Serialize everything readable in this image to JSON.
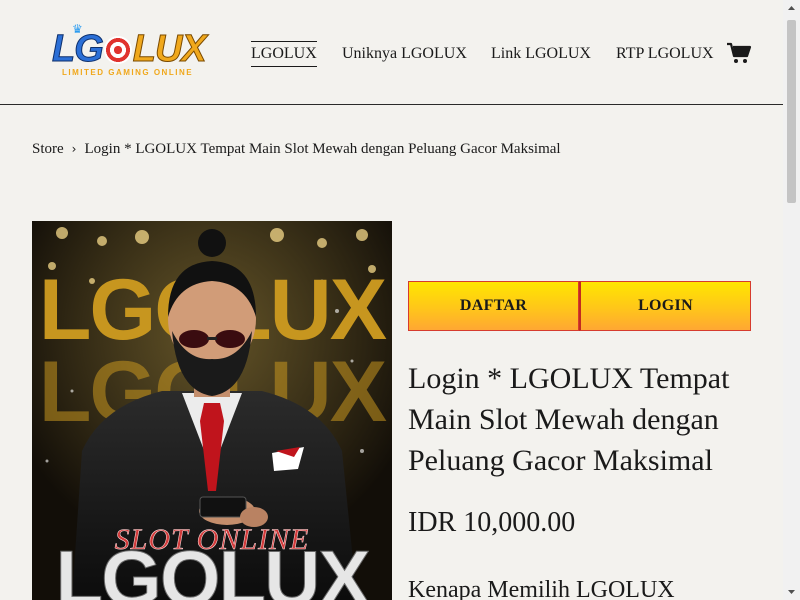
{
  "logo": {
    "text_part1": "LG",
    "text_part2": "LUX",
    "tagline": "LIMITED GAMING ONLINE"
  },
  "nav": {
    "items": [
      {
        "label": "LGOLUX",
        "active": true
      },
      {
        "label": "Uniknya LGOLUX",
        "active": false
      },
      {
        "label": "Link LGOLUX",
        "active": false
      },
      {
        "label": "RTP LGOLUX",
        "active": false
      }
    ],
    "cart_icon": "cart-icon"
  },
  "breadcrumb": {
    "root": "Store",
    "separator": "›",
    "current": "Login * LGOLUX Tempat Main Slot Mewah dengan Peluang Gacor Maksimal"
  },
  "product_image": {
    "big_text": "LGOLUX",
    "script_text": "SLOT ONLINE",
    "bottom_text": "LGOLUX"
  },
  "buttons": {
    "daftar": "DAFTAR",
    "login": "LOGIN"
  },
  "product": {
    "title": "Login * LGOLUX Tempat Main Slot Mewah dengan Peluang Gacor Maksimal",
    "price": "IDR 10,000.00",
    "subheading": "Kenapa Memilih LGOLUX"
  },
  "colors": {
    "background": "#f3f2ee",
    "button_gradient_top": "#ffe600",
    "button_gradient_bottom": "#ffa733",
    "button_border": "#d63b2e"
  }
}
